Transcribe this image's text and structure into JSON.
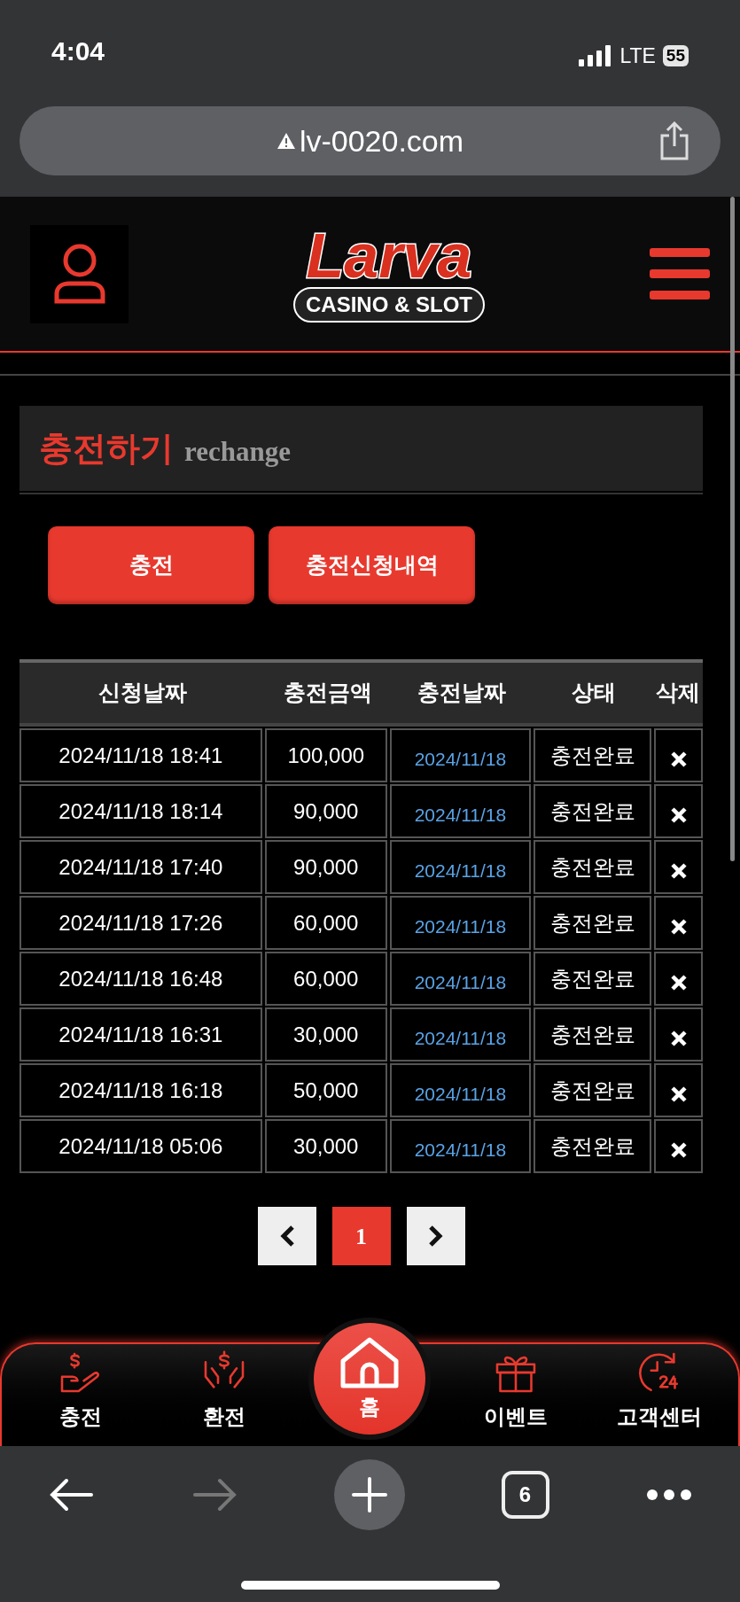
{
  "status_bar": {
    "time": "4:04",
    "network": "LTE",
    "battery": "55"
  },
  "browser": {
    "url": "lv-0020.com",
    "tab_count": "6"
  },
  "header": {
    "logo_title": "Larva",
    "logo_subtitle": "CASINO & SLOT"
  },
  "page_title": {
    "korean": "충전하기",
    "english": "rechange"
  },
  "actions": [
    {
      "label": "충전"
    },
    {
      "label": "충전신청내역"
    }
  ],
  "table": {
    "columns": [
      "신청날짜",
      "충전금액",
      "충전날짜",
      "상태",
      "삭제"
    ],
    "rows": [
      {
        "requested": "2024/11/18 18:41",
        "amount": "100,000",
        "charged": "2024/11/18",
        "status": "충전완료"
      },
      {
        "requested": "2024/11/18 18:14",
        "amount": "90,000",
        "charged": "2024/11/18",
        "status": "충전완료"
      },
      {
        "requested": "2024/11/18 17:40",
        "amount": "90,000",
        "charged": "2024/11/18",
        "status": "충전완료"
      },
      {
        "requested": "2024/11/18 17:26",
        "amount": "60,000",
        "charged": "2024/11/18",
        "status": "충전완료"
      },
      {
        "requested": "2024/11/18 16:48",
        "amount": "60,000",
        "charged": "2024/11/18",
        "status": "충전완료"
      },
      {
        "requested": "2024/11/18 16:31",
        "amount": "30,000",
        "charged": "2024/11/18",
        "status": "충전완료"
      },
      {
        "requested": "2024/11/18 16:18",
        "amount": "50,000",
        "charged": "2024/11/18",
        "status": "충전완료"
      },
      {
        "requested": "2024/11/18 05:06",
        "amount": "30,000",
        "charged": "2024/11/18",
        "status": "충전완료"
      }
    ]
  },
  "pagination": {
    "pages": [
      {
        "label": "1",
        "selected": true
      }
    ]
  },
  "bottom_nav": [
    {
      "kind": "charge",
      "label": "충전"
    },
    {
      "kind": "exchange",
      "label": "환전"
    },
    {
      "kind": "home",
      "label": "홈"
    },
    {
      "kind": "event",
      "label": "이벤트"
    },
    {
      "kind": "support",
      "label": "고객센터"
    }
  ]
}
